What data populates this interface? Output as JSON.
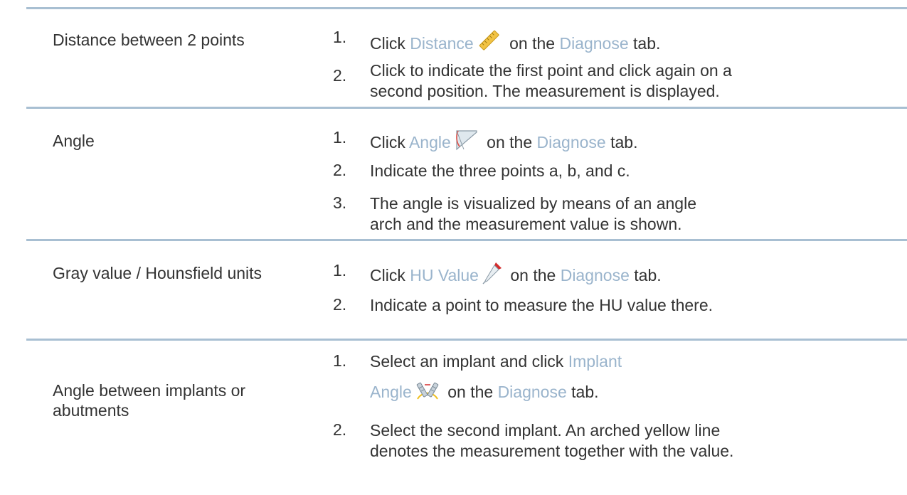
{
  "rows": [
    {
      "label": "Distance between 2 points",
      "steps": [
        {
          "num": "1.",
          "pre": "Click ",
          "ui": "Distance",
          "icon": "ruler-icon",
          "mid": " on the ",
          "tab": "Diagnose",
          "post": " tab."
        },
        {
          "num": "2.",
          "line1": "Click to indicate the first point and click again on a",
          "line2": "second position. The measurement is displayed."
        }
      ]
    },
    {
      "label": "Angle",
      "steps": [
        {
          "num": "1.",
          "pre": "Click ",
          "ui": "Angle",
          "icon": "protractor-icon",
          "mid": " on the ",
          "tab": "Diagnose",
          "post": " tab."
        },
        {
          "num": "2.",
          "line1": "Indicate the three points a, b, and c."
        },
        {
          "num": "3.",
          "line1": "The angle is visualized by means of an angle",
          "line2": "arch and the measurement value is shown."
        }
      ]
    },
    {
      "label": "Gray value / Hounsfield units",
      "steps": [
        {
          "num": "1.",
          "pre": "Click ",
          "ui": "HU Value",
          "icon": "eyedropper-icon",
          "mid": " on the ",
          "tab": "Diagnose",
          "post": " tab."
        },
        {
          "num": "2.",
          "line1": "Indicate a point to measure the HU value there."
        }
      ]
    },
    {
      "label_line1": "Angle between implants or",
      "label_line2": "abutments",
      "steps": [
        {
          "num": "1.",
          "pre": "Select an implant and click ",
          "ui_line1": "Implant",
          "ui_line2": "Angle",
          "icon": "implant-angle-icon",
          "mid": " on the ",
          "tab": "Diagnose",
          "post": " tab."
        },
        {
          "num": "2.",
          "line1": "Select the second implant. An arched yellow line",
          "line2": "denotes the measurement together with the value."
        }
      ]
    }
  ]
}
